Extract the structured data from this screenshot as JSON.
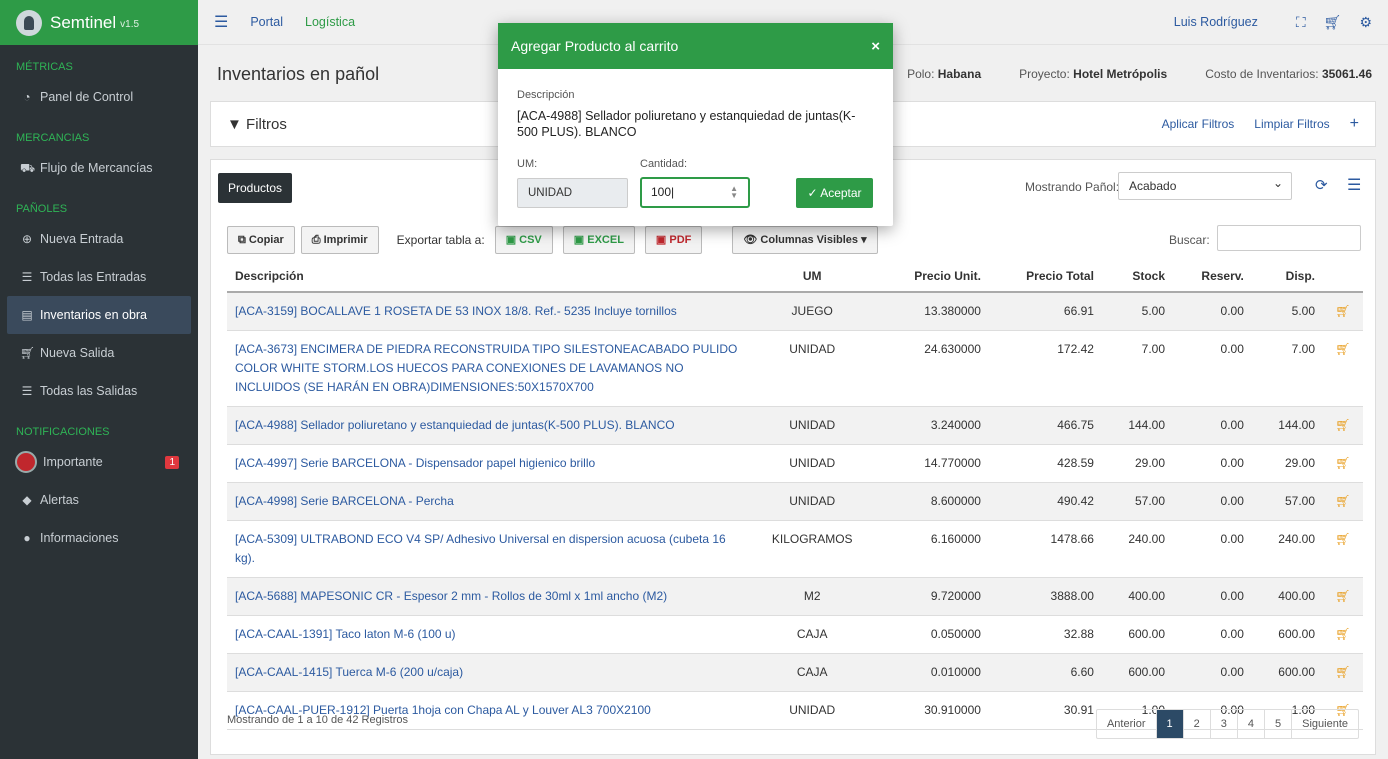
{
  "brand": {
    "name": "Semtinel",
    "version": "v1.5"
  },
  "sidebar": {
    "sections": [
      {
        "title": "MÉTRICAS",
        "items": [
          {
            "label": "Panel de Control",
            "icon": "dashboard-icon"
          }
        ]
      },
      {
        "title": "MERCANCIAS",
        "items": [
          {
            "label": "Flujo de Mercancías",
            "icon": "truck-icon"
          }
        ]
      },
      {
        "title": "PAÑOLES",
        "items": [
          {
            "label": "Nueva Entrada",
            "icon": "plus-circle-icon"
          },
          {
            "label": "Todas las Entradas",
            "icon": "list-icon"
          },
          {
            "label": "Inventarios en obra",
            "icon": "inventory-icon",
            "active": true
          },
          {
            "label": "Nueva Salida",
            "icon": "cart-icon"
          },
          {
            "label": "Todas las Salidas",
            "icon": "list-icon"
          }
        ]
      },
      {
        "title": "NOTIFICACIONES",
        "items": [
          {
            "label": "Importante",
            "icon": "alert-icon",
            "badge": "1"
          },
          {
            "label": "Alertas",
            "icon": "diamond-icon"
          },
          {
            "label": "Informaciones",
            "icon": "info-icon"
          }
        ]
      }
    ]
  },
  "topbar": {
    "links": [
      "Portal",
      "Logística"
    ],
    "user": "Luis Rodríguez"
  },
  "page": {
    "title": "Inventarios en pañol",
    "polo_label": "Polo:",
    "polo_value": "Habana",
    "proyecto_label": "Proyecto:",
    "proyecto_value": "Hotel Metrópolis",
    "costo_label": "Costo de Inventarios:",
    "costo_value": "35061.46"
  },
  "filters": {
    "title": "Filtros",
    "apply": "Aplicar Filtros",
    "clear": "Limpiar Filtros",
    "add": "+"
  },
  "products": {
    "button": "Productos",
    "mostrando_label": "Mostrando Pañol:",
    "panol_selected": "Acabado",
    "toolbar": {
      "copy": "Copiar",
      "print": "Imprimir",
      "export_label": "Exportar tabla a:",
      "csv": "CSV",
      "excel": "EXCEL",
      "pdf": "PDF",
      "columns": "Columnas Visibles"
    },
    "search_label": "Buscar:",
    "columns": [
      "Descripción",
      "UM",
      "Precio Unit.",
      "Precio Total",
      "Stock",
      "Reserv.",
      "Disp."
    ],
    "rows": [
      [
        "[ACA-3159] BOCALLAVE 1 ROSETA DE 53 INOX 18/8. Ref.- 5235 Incluye tornillos",
        "JUEGO",
        "13.380000",
        "66.91",
        "5.00",
        "0.00",
        "5.00"
      ],
      [
        "[ACA-3673] ENCIMERA DE PIEDRA RECONSTRUIDA TIPO SILESTONEACABADO PULIDO COLOR WHITE STORM.LOS HUECOS PARA CONEXIONES DE LAVAMANOS NO INCLUIDOS (SE HARÁN EN OBRA)DIMENSIONES:50X1570X700",
        "UNIDAD",
        "24.630000",
        "172.42",
        "7.00",
        "0.00",
        "7.00"
      ],
      [
        "[ACA-4988] Sellador poliuretano y estanquiedad de juntas(K-500 PLUS). BLANCO",
        "UNIDAD",
        "3.240000",
        "466.75",
        "144.00",
        "0.00",
        "144.00"
      ],
      [
        "[ACA-4997] Serie BARCELONA - Dispensador papel higienico brillo",
        "UNIDAD",
        "14.770000",
        "428.59",
        "29.00",
        "0.00",
        "29.00"
      ],
      [
        "[ACA-4998] Serie BARCELONA - Percha",
        "UNIDAD",
        "8.600000",
        "490.42",
        "57.00",
        "0.00",
        "57.00"
      ],
      [
        "[ACA-5309] ULTRABOND ECO V4 SP/ Adhesivo Universal en dispersion acuosa (cubeta 16 kg).",
        "KILOGRAMOS",
        "6.160000",
        "1478.66",
        "240.00",
        "0.00",
        "240.00"
      ],
      [
        "[ACA-5688] MAPESONIC CR - Espesor 2 mm - Rollos de 30ml x 1ml ancho (M2)",
        "M2",
        "9.720000",
        "3888.00",
        "400.00",
        "0.00",
        "400.00"
      ],
      [
        "[ACA-CAAL-1391] Taco laton M-6 (100 u)",
        "CAJA",
        "0.050000",
        "32.88",
        "600.00",
        "0.00",
        "600.00"
      ],
      [
        "[ACA-CAAL-1415] Tuerca M-6 (200 u/caja)",
        "CAJA",
        "0.010000",
        "6.60",
        "600.00",
        "0.00",
        "600.00"
      ],
      [
        "[ACA-CAAL-PUER-1912] Puerta 1hoja con Chapa AL y Louver AL3 700X2100",
        "UNIDAD",
        "30.910000",
        "30.91",
        "1.00",
        "0.00",
        "1.00"
      ]
    ],
    "footer": "Mostrando de 1 a 10 de 42 Registros",
    "pager": [
      "Anterior",
      "1",
      "2",
      "3",
      "4",
      "5",
      "Siguiente"
    ]
  },
  "modal": {
    "title": "Agregar Producto al carrito",
    "close": "×",
    "desc_label": "Descripción",
    "desc_value": "[ACA-4988] Sellador poliuretano y estanquiedad de juntas(K-500 PLUS). BLANCO",
    "um_label": "UM:",
    "um_value": "UNIDAD",
    "cant_label": "Cantidad:",
    "cant_value": "100",
    "accept": "Aceptar"
  },
  "colors": {
    "brand_green": "#2e9b47",
    "link_blue": "#2c5aa0",
    "sidebar_bg": "#2b3236",
    "cart_orange": "#e89c1a"
  }
}
